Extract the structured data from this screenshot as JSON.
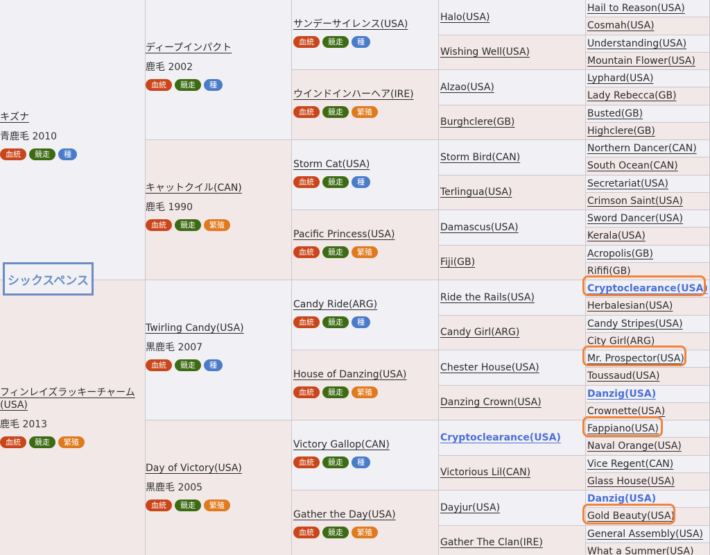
{
  "title": "シックスペンス",
  "tags": {
    "blood": "血統",
    "race": "競走",
    "stud": "種",
    "breed": "繁殖"
  },
  "gen1": [
    {
      "name": "キズナ",
      "color_year": "青鹿毛 2010",
      "type": "stud"
    },
    {
      "name": "フィンレイズラッキーチャーム(USA)",
      "color_year": "鹿毛 2013",
      "type": "breed"
    }
  ],
  "gen2": [
    {
      "name": "ディープインパクト",
      "color_year": "鹿毛 2002",
      "type": "stud"
    },
    {
      "name": "キャットクイル(CAN)",
      "color_year": "鹿毛 1990",
      "type": "breed"
    },
    {
      "name": "Twirling Candy(USA)",
      "color_year": "黒鹿毛 2007",
      "type": "stud"
    },
    {
      "name": "Day of Victory(USA)",
      "color_year": "黒鹿毛 2005",
      "type": "breed"
    }
  ],
  "gen3": [
    {
      "name": "サンデーサイレンス(USA)",
      "type": "stud"
    },
    {
      "name": "ウインドインハーヘア(IRE)",
      "type": "breed"
    },
    {
      "name": "Storm Cat(USA)",
      "type": "stud"
    },
    {
      "name": "Pacific Princess(USA)",
      "type": "breed"
    },
    {
      "name": "Candy Ride(ARG)",
      "type": "stud"
    },
    {
      "name": "House of Danzing(USA)",
      "type": "breed"
    },
    {
      "name": "Victory Gallop(CAN)",
      "type": "stud"
    },
    {
      "name": "Gather the Day(USA)",
      "type": "breed"
    }
  ],
  "gen4": [
    "Halo(USA)",
    "Wishing Well(USA)",
    "Alzao(USA)",
    "Burghclere(GB)",
    "Storm Bird(CAN)",
    "Terlingua(USA)",
    "Damascus(USA)",
    "Fiji(GB)",
    "Ride the Rails(USA)",
    "Candy Girl(ARG)",
    "Chester House(USA)",
    "Danzing Crown(USA)",
    "Cryptoclearance(USA)",
    "Victorious Lil(CAN)",
    "Dayjur(USA)",
    "Gather The Clan(IRE)"
  ],
  "gen5": [
    "Hail to Reason(USA)",
    "Cosmah(USA)",
    "Understanding(USA)",
    "Mountain Flower(USA)",
    "Lyphard(USA)",
    "Lady Rebecca(GB)",
    "Busted(GB)",
    "Highclere(GB)",
    "Northern Dancer(CAN)",
    "South Ocean(CAN)",
    "Secretariat(USA)",
    "Crimson Saint(USA)",
    "Sword Dancer(USA)",
    "Kerala(USA)",
    "Acropolis(GB)",
    "Rififi(GB)",
    "Cryptoclearance(USA)",
    "Herbalesian(USA)",
    "Candy Stripes(USA)",
    "City Girl(ARG)",
    "Mr. Prospector(USA)",
    "Toussaud(USA)",
    "Danzig(USA)",
    "Crownette(USA)",
    "Fappiano(USA)",
    "Naval Orange(USA)",
    "Vice Regent(CAN)",
    "Glass House(USA)",
    "Danzig(USA)",
    "Gold Beauty(USA)",
    "General Assembly(USA)",
    "What a Summer(USA)"
  ]
}
